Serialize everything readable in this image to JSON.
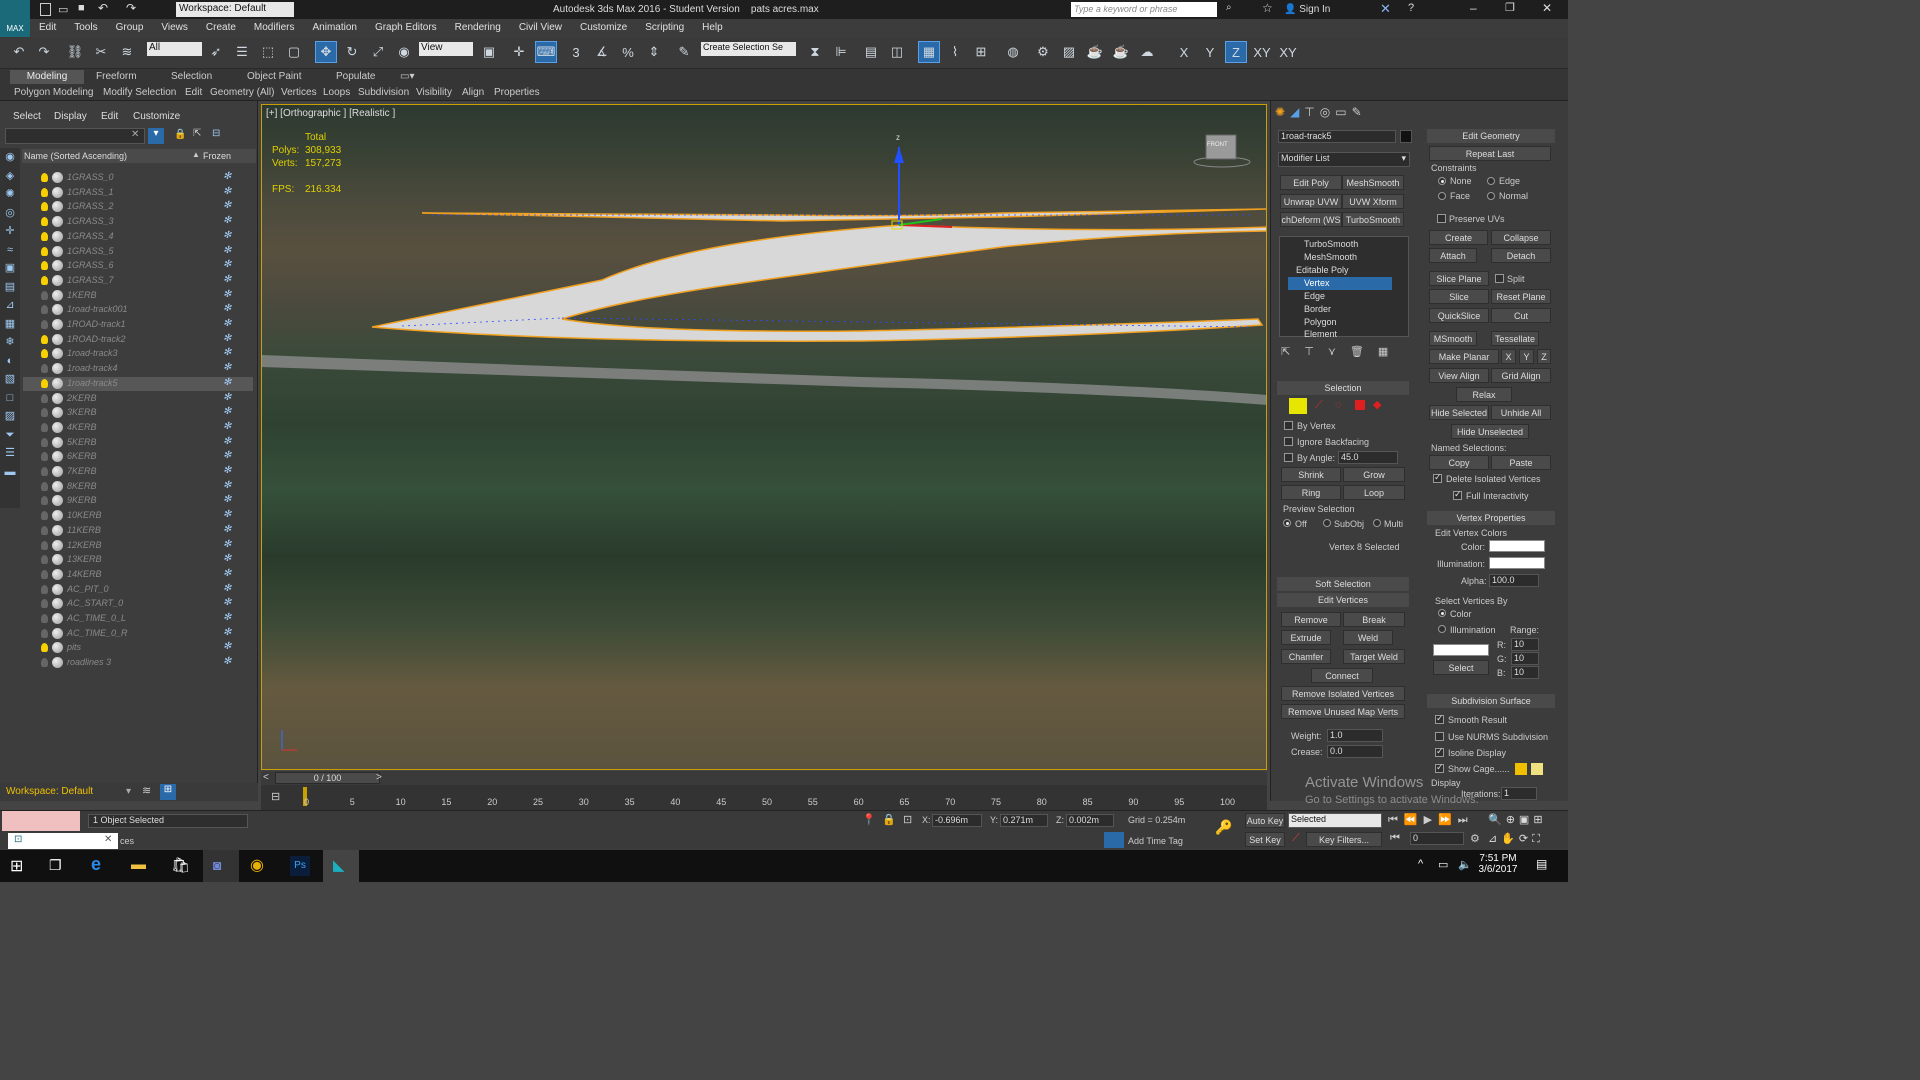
{
  "title": {
    "app": "Autodesk 3ds Max 2016 - Student Version",
    "file": "pats acres.max",
    "workspace": "Workspace: Default",
    "search_placeholder": "Type a keyword or phrase",
    "sign_in": "Sign In",
    "app_badge": "MAX"
  },
  "menu": [
    "Edit",
    "Tools",
    "Group",
    "Views",
    "Create",
    "Modifiers",
    "Animation",
    "Graph Editors",
    "Rendering",
    "Civil View",
    "Customize",
    "Scripting",
    "Help"
  ],
  "toolbar": {
    "filter_all": "All",
    "view": "View",
    "selection_set": "Create Selection Se",
    "axes": [
      "X",
      "Y",
      "Z",
      "XY",
      "XY"
    ],
    "snap_labels": [
      "3",
      "%"
    ]
  },
  "ribbon": {
    "tabs": [
      "Modeling",
      "Freeform",
      "Selection",
      "Object Paint",
      "Populate"
    ],
    "items": [
      "Polygon Modeling",
      "Modify Selection",
      "Edit",
      "Geometry (All)",
      "Vertices",
      "Loops",
      "Subdivision",
      "Visibility",
      "Align",
      "Properties"
    ]
  },
  "explorer": {
    "menu": [
      "Select",
      "Display",
      "Edit",
      "Customize"
    ],
    "col_name": "Name (Sorted Ascending)",
    "col_frozen": "Frozen",
    "items": [
      {
        "n": "1GRASS_0",
        "on": true
      },
      {
        "n": "1GRASS_1",
        "on": true
      },
      {
        "n": "1GRASS_2",
        "on": true
      },
      {
        "n": "1GRASS_3",
        "on": true
      },
      {
        "n": "1GRASS_4",
        "on": true
      },
      {
        "n": "1GRASS_5",
        "on": true
      },
      {
        "n": "1GRASS_6",
        "on": true
      },
      {
        "n": "1GRASS_7",
        "on": true
      },
      {
        "n": "1KERB",
        "on": false
      },
      {
        "n": "1road-track001",
        "on": false
      },
      {
        "n": "1ROAD-track1",
        "on": false
      },
      {
        "n": "1ROAD-track2",
        "on": true
      },
      {
        "n": "1road-track3",
        "on": true
      },
      {
        "n": "1road-track4",
        "on": false
      },
      {
        "n": "1road-track5",
        "on": true
      },
      {
        "n": "2KERB",
        "on": false
      },
      {
        "n": "3KERB",
        "on": false
      },
      {
        "n": "4KERB",
        "on": false
      },
      {
        "n": "5KERB",
        "on": false
      },
      {
        "n": "6KERB",
        "on": false
      },
      {
        "n": "7KERB",
        "on": false
      },
      {
        "n": "8KERB",
        "on": false
      },
      {
        "n": "9KERB",
        "on": false
      },
      {
        "n": "10KERB",
        "on": false
      },
      {
        "n": "11KERB",
        "on": false
      },
      {
        "n": "12KERB",
        "on": false
      },
      {
        "n": "13KERB",
        "on": false
      },
      {
        "n": "14KERB",
        "on": false
      },
      {
        "n": "AC_PIT_0",
        "on": false
      },
      {
        "n": "AC_START_0",
        "on": false
      },
      {
        "n": "AC_TIME_0_L",
        "on": false
      },
      {
        "n": "AC_TIME_0_R",
        "on": false
      },
      {
        "n": "pits",
        "on": true
      },
      {
        "n": "roadlines 3",
        "on": false
      }
    ],
    "selected_index": 14,
    "workspace": "Workspace: Default"
  },
  "viewport": {
    "label": "[+] [Orthographic ] [Realistic ]",
    "total": "Total",
    "polys_label": "Polys:",
    "polys": "308,933",
    "verts_label": "Verts:",
    "verts": "157,273",
    "fps_label": "FPS:",
    "fps": "216.334",
    "gizmo_z": "z",
    "viewcube": "FRONT"
  },
  "timeline": {
    "pos": "0 / 100",
    "ticks": [
      "0",
      "5",
      "10",
      "15",
      "20",
      "25",
      "30",
      "35",
      "40",
      "45",
      "50",
      "55",
      "60",
      "65",
      "70",
      "75",
      "80",
      "85",
      "90",
      "95",
      "100"
    ]
  },
  "cmd": {
    "object_name": "1road-track5",
    "modifier_list": "Modifier List",
    "mod_buttons": [
      "Edit Poly",
      "MeshSmooth",
      "Unwrap UVW",
      "UVW Xform",
      "chDeform (WS",
      "TurboSmooth"
    ],
    "stack": [
      "TurboSmooth",
      "MeshSmooth",
      "Editable Poly",
      "Vertex",
      "Edge",
      "Border",
      "Polygon",
      "Element"
    ],
    "selection": {
      "title": "Selection",
      "by_vertex": "By Vertex",
      "ignore_backfacing": "Ignore Backfacing",
      "by_angle": "By Angle:",
      "angle": "45.0",
      "shrink": "Shrink",
      "grow": "Grow",
      "ring": "Ring",
      "loop": "Loop",
      "preview": "Preview Selection",
      "off": "Off",
      "subobj": "SubObj",
      "multi": "Multi",
      "status": "Vertex 8 Selected"
    },
    "soft_selection": "Soft Selection",
    "edit_vertices": {
      "title": "Edit Vertices",
      "remove": "Remove",
      "break": "Break",
      "extrude": "Extrude",
      "weld": "Weld",
      "chamfer": "Chamfer",
      "target_weld": "Target Weld",
      "connect": "Connect",
      "remove_isolated": "Remove Isolated Vertices",
      "remove_unused": "Remove Unused Map Verts",
      "weight_label": "Weight:",
      "weight": "1.0",
      "crease_label": "Crease:",
      "crease": "0.0"
    },
    "edit_geometry": {
      "title": "Edit Geometry",
      "repeat_last": "Repeat Last",
      "constraints": "Constraints",
      "none": "None",
      "edge": "Edge",
      "face": "Face",
      "normal": "Normal",
      "preserve_uvs": "Preserve UVs",
      "create": "Create",
      "collapse": "Collapse",
      "attach": "Attach",
      "detach": "Detach",
      "slice_plane": "Slice Plane",
      "split": "Split",
      "slice": "Slice",
      "reset_plane": "Reset Plane",
      "quickslice": "QuickSlice",
      "cut": "Cut",
      "msmooth": "MSmooth",
      "tessellate": "Tessellate",
      "make_planar": "Make Planar",
      "x": "X",
      "y": "Y",
      "z": "Z",
      "view_align": "View Align",
      "grid_align": "Grid Align",
      "relax": "Relax",
      "hide_selected": "Hide Selected",
      "unhide_all": "Unhide All",
      "hide_unselected": "Hide Unselected",
      "named_sel": "Named Selections:",
      "copy": "Copy",
      "paste": "Paste",
      "delete_isolated": "Delete Isolated Vertices",
      "full_interactivity": "Full Interactivity"
    },
    "vertex_props": {
      "title": "Vertex Properties",
      "edit_colors": "Edit Vertex Colors",
      "color": "Color:",
      "illumination": "Illumination:",
      "alpha": "Alpha:",
      "alpha_val": "100.0",
      "select_by": "Select Vertices By",
      "by_color": "Color",
      "by_illum": "Illumination",
      "range": "Range:",
      "r": "R:",
      "g": "G:",
      "b": "B:",
      "rv": "10",
      "gv": "10",
      "bv": "10",
      "select": "Select"
    },
    "subdiv": {
      "title": "Subdivision Surface",
      "smooth_result": "Smooth Result",
      "use_nurms": "Use NURMS Subdivision",
      "isoline": "Isoline Display",
      "show_cage": "Show Cage......",
      "display": "Display",
      "iterations": "Iterations:",
      "iter_val": "1"
    }
  },
  "status": {
    "selected": "1 Object Selected",
    "x_label": "X:",
    "x": "-0.696m",
    "y_label": "Y:",
    "y": "0.271m",
    "z_label": "Z:",
    "z": "0.002m",
    "grid": "Grid = 0.254m",
    "auto_key": "Auto Key",
    "set_key": "Set Key",
    "selected_dd": "Selected",
    "key_filters": "Key Filters...",
    "add_time_tag": "Add Time Tag",
    "frame": "0",
    "prompt": "ces"
  },
  "watermark": {
    "line1": "Activate Windows",
    "line2": "Go to Settings to activate Windows."
  },
  "taskbar": {
    "time": "7:51 PM",
    "date": "3/6/2017"
  }
}
